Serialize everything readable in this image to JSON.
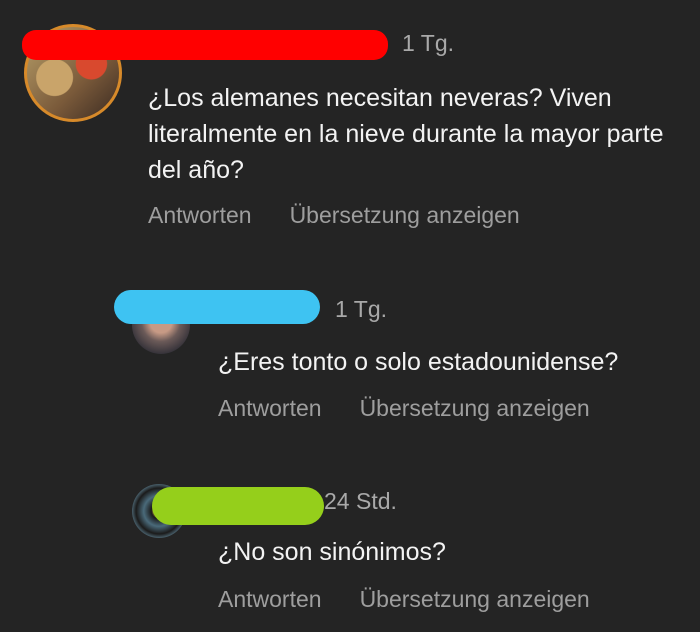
{
  "comments": [
    {
      "time": "1 Tg.",
      "text": "¿Los alemanes necesitan neveras? Viven literalmente en la nieve durante la mayor parte del año?",
      "reply_label": "Antworten",
      "translate_label": "Übersetzung anzeigen",
      "redaction_color": "#ff0000"
    },
    {
      "time": "1 Tg.",
      "text": "¿Eres tonto o solo estadounidense?",
      "reply_label": "Antworten",
      "translate_label": "Übersetzung anzeigen",
      "redaction_color": "#3ec3f2"
    },
    {
      "time": "24 Std.",
      "text": "¿No son sinónimos?",
      "reply_label": "Antworten",
      "translate_label": "Übersetzung anzeigen",
      "redaction_color": "#95cf1b"
    }
  ]
}
